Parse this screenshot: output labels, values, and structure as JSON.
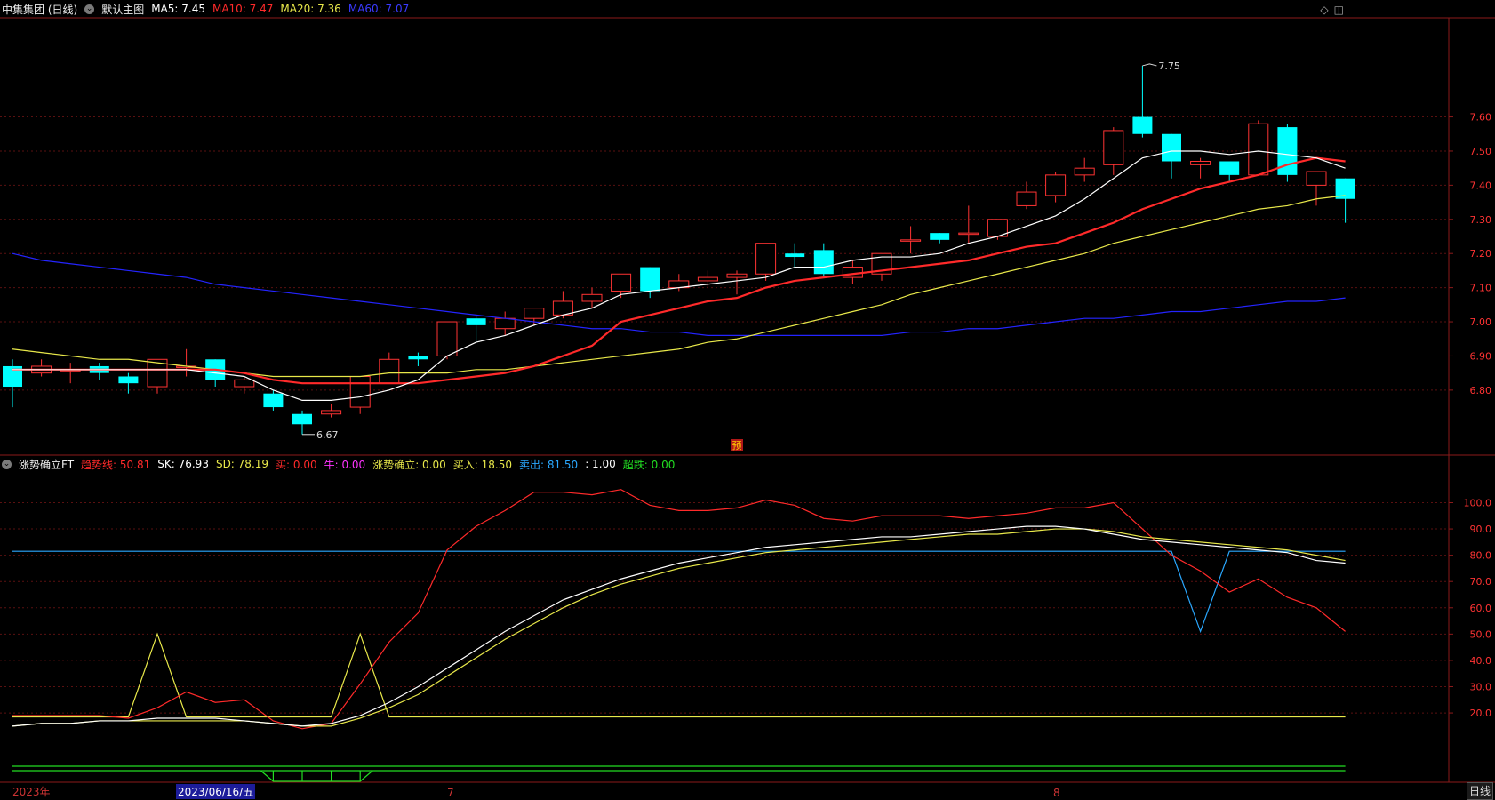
{
  "header": {
    "stock_name": "中集集团 (日线)",
    "main_chart_label": "默认主图",
    "ma5_label": "MA5: 7.45",
    "ma10_label": "MA10: 7.47",
    "ma20_label": "MA20: 7.36",
    "ma60_label": "MA60: 7.07",
    "colors": {
      "ma5": "#ffffff",
      "ma10": "#ff2a2a",
      "ma20": "#e8e84a",
      "ma60": "#2424ff"
    }
  },
  "indicator_header": {
    "name": "涨势确立FT",
    "items": [
      {
        "text": "趋势线: 50.81",
        "color": "#ff2a2a"
      },
      {
        "text": "SK: 76.93",
        "color": "#ffffff"
      },
      {
        "text": "SD: 78.19",
        "color": "#e8e84a"
      },
      {
        "text": "买: 0.00",
        "color": "#ff2a2a"
      },
      {
        "text": "牛: 0.00",
        "color": "#ff33ff"
      },
      {
        "text": "涨势确立: 0.00",
        "color": "#e8e84a"
      },
      {
        "text": "买入: 18.50",
        "color": "#e8e84a"
      },
      {
        "text": "卖出: 81.50",
        "color": "#2aa8ff"
      },
      {
        "text": ": 1.00",
        "color": "#ffffff"
      },
      {
        "text": "超跌: 0.00",
        "color": "#22dd22"
      }
    ]
  },
  "corner_icons": [
    "diamond-icon",
    "window-icon"
  ],
  "price_axis": [
    "7.60",
    "7.50",
    "7.40",
    "7.30",
    "7.20",
    "7.10",
    "7.00",
    "6.90",
    "6.80"
  ],
  "indicator_axis": [
    "100.0",
    "90.0",
    "80.0",
    "70.0",
    "60.0",
    "50.0",
    "40.0",
    "30.0",
    "20.0"
  ],
  "annotations": {
    "high": "7.75",
    "low": "6.67",
    "forecast": "预"
  },
  "x_axis": {
    "year": "2023年",
    "date": "2023/06/16/五",
    "m7": "7",
    "m8": "8"
  },
  "bottom_tab": "日线",
  "chart_data": {
    "type": "candlestick",
    "ylim": [
      6.62,
      7.88
    ],
    "candles": [
      [
        6.87,
        6.81,
        6.89,
        6.75
      ],
      [
        6.85,
        6.87,
        6.89,
        6.84
      ],
      [
        6.86,
        6.86,
        6.88,
        6.82
      ],
      [
        6.87,
        6.85,
        6.88,
        6.83
      ],
      [
        6.84,
        6.82,
        6.85,
        6.79
      ],
      [
        6.81,
        6.89,
        6.89,
        6.79
      ],
      [
        6.87,
        6.87,
        6.92,
        6.84
      ],
      [
        6.89,
        6.83,
        6.89,
        6.81
      ],
      [
        6.81,
        6.83,
        6.84,
        6.79
      ],
      [
        6.79,
        6.75,
        6.8,
        6.74
      ],
      [
        6.73,
        6.7,
        6.74,
        6.67
      ],
      [
        6.73,
        6.74,
        6.76,
        6.72
      ],
      [
        6.75,
        6.84,
        6.84,
        6.73
      ],
      [
        6.82,
        6.89,
        6.91,
        6.82
      ],
      [
        6.9,
        6.89,
        6.91,
        6.87
      ],
      [
        6.9,
        7.0,
        7.0,
        6.89
      ],
      [
        7.01,
        6.99,
        7.02,
        6.94
      ],
      [
        6.98,
        7.01,
        7.03,
        6.96
      ],
      [
        7.01,
        7.04,
        7.04,
        6.99
      ],
      [
        7.02,
        7.06,
        7.09,
        7.01
      ],
      [
        7.06,
        7.08,
        7.1,
        7.04
      ],
      [
        7.09,
        7.14,
        7.14,
        7.07
      ],
      [
        7.16,
        7.09,
        7.16,
        7.07
      ],
      [
        7.1,
        7.12,
        7.14,
        7.09
      ],
      [
        7.12,
        7.13,
        7.15,
        7.1
      ],
      [
        7.13,
        7.14,
        7.15,
        7.08
      ],
      [
        7.14,
        7.23,
        7.23,
        7.12
      ],
      [
        7.2,
        7.19,
        7.23,
        7.16
      ],
      [
        7.21,
        7.14,
        7.23,
        7.13
      ],
      [
        7.13,
        7.16,
        7.18,
        7.11
      ],
      [
        7.14,
        7.2,
        7.2,
        7.12
      ],
      [
        7.24,
        7.24,
        7.28,
        7.2
      ],
      [
        7.26,
        7.24,
        7.26,
        7.23
      ],
      [
        7.26,
        7.26,
        7.34,
        7.23
      ],
      [
        7.25,
        7.3,
        7.3,
        7.24
      ],
      [
        7.34,
        7.38,
        7.41,
        7.33
      ],
      [
        7.37,
        7.43,
        7.44,
        7.35
      ],
      [
        7.43,
        7.45,
        7.48,
        7.41
      ],
      [
        7.46,
        7.56,
        7.57,
        7.43
      ],
      [
        7.6,
        7.55,
        7.75,
        7.54
      ],
      [
        7.55,
        7.47,
        7.55,
        7.42
      ],
      [
        7.46,
        7.47,
        7.48,
        7.42
      ],
      [
        7.47,
        7.43,
        7.47,
        7.41
      ],
      [
        7.43,
        7.58,
        7.59,
        7.43
      ],
      [
        7.57,
        7.43,
        7.58,
        7.41
      ],
      [
        7.4,
        7.44,
        7.44,
        7.34
      ],
      [
        7.42,
        7.36,
        7.42,
        7.29
      ]
    ],
    "ma5": [
      6.86,
      6.86,
      6.86,
      6.86,
      6.86,
      6.86,
      6.86,
      6.85,
      6.84,
      6.8,
      6.77,
      6.77,
      6.78,
      6.8,
      6.83,
      6.9,
      6.94,
      6.96,
      6.99,
      7.02,
      7.04,
      7.08,
      7.09,
      7.1,
      7.11,
      7.12,
      7.13,
      7.16,
      7.16,
      7.18,
      7.19,
      7.19,
      7.2,
      7.23,
      7.25,
      7.28,
      7.31,
      7.36,
      7.42,
      7.48,
      7.5,
      7.5,
      7.49,
      7.5,
      7.49,
      7.48,
      7.45
    ],
    "ma10": [
      6.86,
      6.86,
      6.86,
      6.86,
      6.86,
      6.86,
      6.86,
      6.86,
      6.85,
      6.83,
      6.82,
      6.82,
      6.82,
      6.82,
      6.82,
      6.83,
      6.84,
      6.85,
      6.87,
      6.9,
      6.93,
      7.0,
      7.02,
      7.04,
      7.06,
      7.07,
      7.1,
      7.12,
      7.13,
      7.14,
      7.15,
      7.16,
      7.17,
      7.18,
      7.2,
      7.22,
      7.23,
      7.26,
      7.29,
      7.33,
      7.36,
      7.39,
      7.41,
      7.43,
      7.46,
      7.48,
      7.47
    ],
    "ma20": [
      6.92,
      6.91,
      6.9,
      6.89,
      6.89,
      6.88,
      6.87,
      6.86,
      6.85,
      6.84,
      6.84,
      6.84,
      6.84,
      6.85,
      6.85,
      6.85,
      6.86,
      6.86,
      6.87,
      6.88,
      6.89,
      6.9,
      6.91,
      6.92,
      6.94,
      6.95,
      6.97,
      6.99,
      7.01,
      7.03,
      7.05,
      7.08,
      7.1,
      7.12,
      7.14,
      7.16,
      7.18,
      7.2,
      7.23,
      7.25,
      7.27,
      7.29,
      7.31,
      7.33,
      7.34,
      7.36,
      7.37
    ],
    "ma60": [
      7.2,
      7.18,
      7.17,
      7.16,
      7.15,
      7.14,
      7.13,
      7.11,
      7.1,
      7.09,
      7.08,
      7.07,
      7.06,
      7.05,
      7.04,
      7.03,
      7.02,
      7.01,
      7.0,
      6.99,
      6.98,
      6.98,
      6.97,
      6.97,
      6.96,
      6.96,
      6.96,
      6.96,
      6.96,
      6.96,
      6.96,
      6.97,
      6.97,
      6.98,
      6.98,
      6.99,
      7.0,
      7.01,
      7.01,
      7.02,
      7.03,
      7.03,
      7.04,
      7.05,
      7.06,
      7.06,
      7.07
    ],
    "indicator": {
      "ylim": [
        -5,
        112
      ],
      "trend": [
        19,
        19,
        19,
        19,
        18,
        22,
        28,
        24,
        25,
        17,
        14,
        16,
        31,
        47,
        58,
        82,
        91,
        97,
        104,
        104,
        103,
        105,
        99,
        97,
        97,
        98,
        101,
        99,
        94,
        93,
        95,
        95,
        95,
        94,
        95,
        96,
        98,
        98,
        100,
        90,
        80,
        74,
        66,
        71,
        64,
        60,
        51
      ],
      "sk": [
        15,
        16,
        16,
        17,
        17,
        18,
        18,
        18,
        17,
        16,
        15,
        16,
        19,
        24,
        30,
        37,
        44,
        51,
        57,
        63,
        67,
        71,
        74,
        77,
        79,
        81,
        83,
        84,
        85,
        86,
        87,
        87,
        88,
        89,
        90,
        91,
        91,
        90,
        88,
        86,
        85,
        84,
        83,
        82,
        81,
        78,
        77
      ],
      "sd": [
        15,
        16,
        16,
        17,
        17,
        17,
        17,
        17,
        17,
        16,
        15,
        15,
        18,
        22,
        27,
        34,
        41,
        48,
        54,
        60,
        65,
        69,
        72,
        75,
        77,
        79,
        81,
        82,
        83,
        84,
        85,
        86,
        87,
        88,
        88,
        89,
        90,
        90,
        89,
        87,
        86,
        85,
        84,
        83,
        82,
        80,
        78
      ],
      "buy_line": 18.5,
      "sell_line": 81.5,
      "sell_dip_index": 41,
      "sell_dip_value": 51,
      "spikes": [
        {
          "index": 5,
          "value": 50
        },
        {
          "index": 12,
          "value": 50
        }
      ]
    }
  }
}
